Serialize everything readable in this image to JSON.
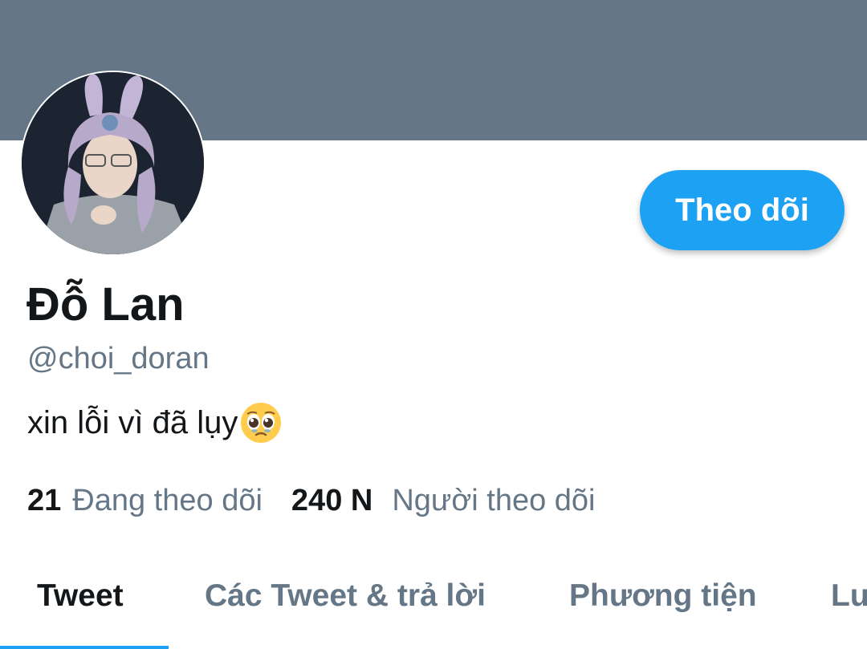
{
  "profile": {
    "display_name": "Đỗ Lan",
    "handle": "@choi_doran",
    "bio_text": "xin lỗi vì đã lụy",
    "bio_emoji": "pleading-face-icon",
    "follow_label": "Theo dõi",
    "avatar_icon": "avatar-photo"
  },
  "stats": {
    "following_count": "21",
    "following_label": "Đang theo dõi",
    "followers_count": "240 N",
    "followers_label": "Người theo dõi"
  },
  "tabs": [
    {
      "label": "Tweet",
      "active": true
    },
    {
      "label": "Các Tweet & trả lời",
      "active": false
    },
    {
      "label": "Phương tiện",
      "active": false
    },
    {
      "label": "Lu",
      "active": false
    }
  ],
  "colors": {
    "banner": "#657786",
    "accent": "#1da1f2",
    "text_primary": "#14171a",
    "text_secondary": "#657786"
  }
}
